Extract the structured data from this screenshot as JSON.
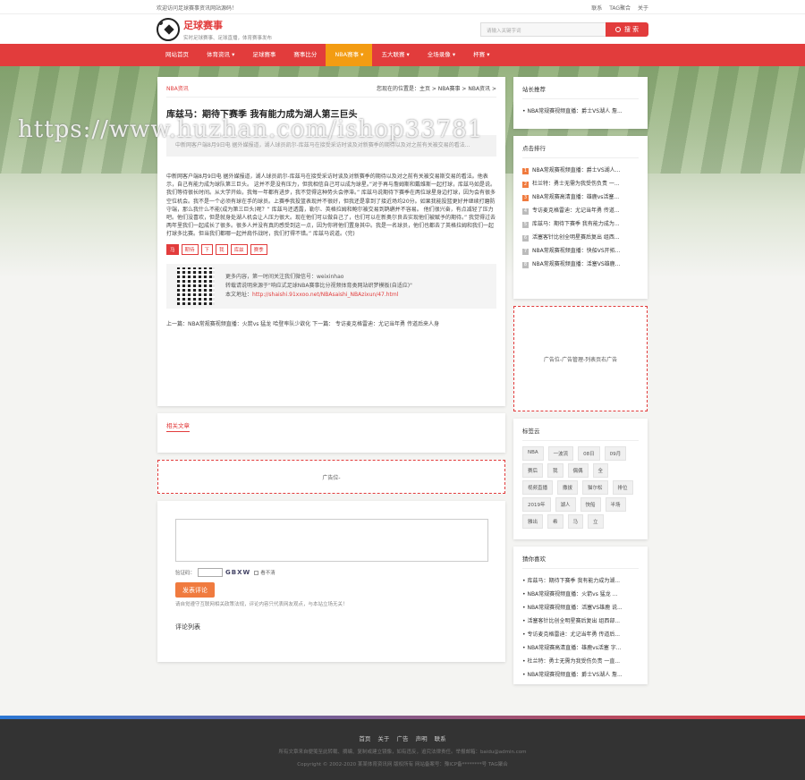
{
  "topbar": {
    "welcome": "欢迎访问足球赛事资讯网站源码！",
    "links": [
      "联系",
      "TAG聚合",
      "关于"
    ]
  },
  "brand": {
    "name": "足球赛事",
    "slogan": "实时足球赛事、足球直播，体育赛事发布"
  },
  "search": {
    "placeholder": "请输入关键字词",
    "button": "搜 索"
  },
  "nav": [
    "网站首页",
    "体育资讯 ▾",
    "足球赛事",
    "赛事比分",
    "NBA赛事 ▾",
    "五大联赛 ▾",
    "全场录像 ▾",
    "杯赛 ▾"
  ],
  "watermark": "https://www.huzhan.com/ishop33781",
  "article": {
    "category": "NBA资讯",
    "breadcrumb": "您现在的位置是：主页 > NBA赛事 > NBA资讯 >",
    "title": "库兹马：期待下赛季 我有能力成为湖人第三巨头",
    "summary": "中新网客户端8月9日电 据外媒报道，湖人球员凯尔-库兹马在接受采访时谈及对新赛季的期待以及对之前有关被交易的看法...",
    "body": "中新网客户端8月9日电 据外媒报道，湖人球员凯尔-库兹马在接受采访时谈及对新赛季的期待以及对之前有关被交易斯交易的看法。他表示，自己有能力成为球队第三巨头。 这并不是没有压力，但我相信自己可以成为球星。”对于再与詹姆斯和戴维斯一起打球，库兹马如是说。我们等待很长时间。从大学开始，我每一年都有进步，我不觉得这种势头会停滞。” 库兹马说期待下赛季在两位球星身边打球，因为会有很多空位机会。我不是一个必须有球在手的球员。上赛季我投篮表现并不很好，但我还是拿到了接近场均20分。如果我能投篮更好并继续打磨防守端，那么我什么不能(成为第三巨头)呢？” 库兹马还透露，勒尔、英格拉姆和鲍尔被交易到鹈鹕并不容易。 他们很兴奋，有点减轻了压力吧。他们没喜欢，但是就身处湖人机会让人压力很大。现在他们可以做自己了，也们可以在新奥尔良去实现他们被赋予的期待。” 我觉得过去两年里我们一起成长了很多。很多人并没有真的感受到这一点，因为你将他们置身其中。我是一名球员，他们也都去了英格拉姆和我们一起打球多比赛。但当我们都哪一起并肩作战时，我们打得不错。” 库兹马说道。(完)",
    "tags": [
      "马",
      "期待",
      "下",
      "我",
      "库兹",
      "赛季"
    ],
    "qr": {
      "line1": "更多内容，第一时间关注我们微信号：weixinhao",
      "line2": "转载请说明来源于\"响应式足球NBA赛事比分视频体育类网站织梦模板(自适应)\"",
      "line3_label": "本文地址：",
      "line3_url": "http://shaishi.91xxoo.net/NBAsaishi_NBAzixun/47.html"
    },
    "prev": "上一篇：NBA常规赛视频直播：火箭vs 猛龙 哈登率队少欲化",
    "next": "下一篇： 专访麦克格雷迪：尤记当年勇 传道后来人身"
  },
  "related": {
    "heading": "相关文章"
  },
  "ad_main": "广告位-",
  "comment": {
    "captcha_label": "验证码：",
    "captcha_code": "GBXW",
    "remember": "看不清",
    "post": "发表评论",
    "rule": "请自觉遵守互联网相关政策法规，评论内容只代表网友观点，与本站立场无关！",
    "list_heading": "评论列表"
  },
  "sidebar": {
    "recommend": {
      "heading": "站长推荐",
      "items": [
        "NBA常规赛视频直播：爵士VS湖人 詹..."
      ]
    },
    "ranking": {
      "heading": "点击排行",
      "items": [
        "NBA常规赛视频直播：爵士VS湖人...",
        "杜兰特：勇士无需为我受伤负责 一...",
        "NBA常规赛高清直播：雄鹿vs活塞...",
        "专访麦克格雷迪：尤记当年勇 传道...",
        "库兹马：期待下赛季 我有能力成为...",
        "活塞客针比创全明星赛后复出 组西...",
        "NBA常规赛视频直播：快船VS开拓...",
        "NBA常规赛视频直播：活塞VS雄鹿..."
      ]
    },
    "ad": "广告位-广告管理-列表页右广告",
    "tags": {
      "heading": "标签云",
      "items": [
        "NBA",
        "一波流",
        "08日",
        "09月",
        "赛后",
        "我",
        "偶偶",
        "全",
        "视频直播",
        "撒拔",
        "猫尔松",
        "排位",
        "2019年",
        "湖人",
        "快船",
        "半场",
        "雅出",
        "希",
        "马",
        "立"
      ]
    },
    "likes": {
      "heading": "猜你喜欢",
      "items": [
        "库兹马：期待下赛季 我有能力成为湖...",
        "NBA常规赛视频直播：火箭vs 猛龙 ...",
        "NBA常规赛视频直播：活塞VS雄鹿 说...",
        "活塞客针比创全明星赛后复出 组西部...",
        "专访麦克格雷迪：尤记当年勇 传道后...",
        "NBA常规赛高清直播：雄鹿vs活塞 字...",
        "杜兰特：勇士无需为我受伤负责 一直...",
        "NBA常规赛视频直播：爵士VS湖人 詹..."
      ]
    }
  },
  "footer": {
    "links": [
      "首页",
      "关于",
      "广告",
      "声明",
      "联系"
    ],
    "line2": "所有文章来自便笺至此转载、摘编、复制或建立镜像，如有违反，追究法律责任。举报邮箱：baidu@admin.com",
    "line3": "Copyright © 2002-2020 某某体育资讯网 版权所有 网站备案号：豫ICP备********号 TAG聚合"
  }
}
